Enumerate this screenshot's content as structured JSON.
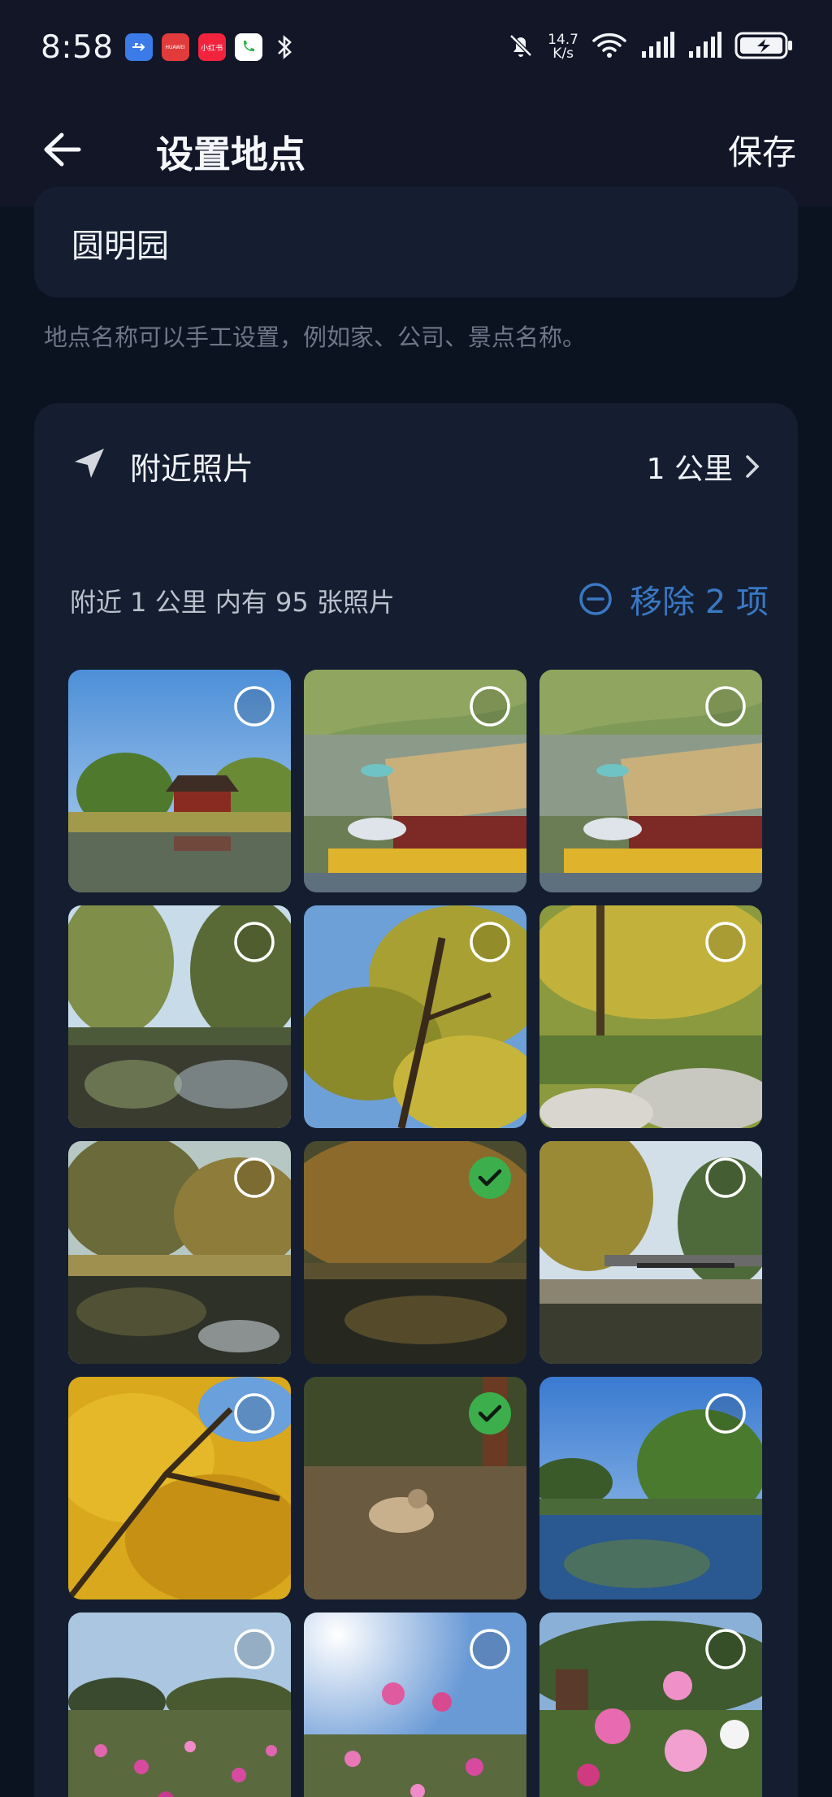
{
  "status_bar": {
    "time": "8:58",
    "notification_icons": [
      "usb-icon",
      "huawei-app-icon",
      "xiaohongshu-icon",
      "phone-call-icon",
      "bluetooth-icon"
    ],
    "notif_labels": {
      "huawei": "HUAWEI",
      "xiaohongshu": "小红书"
    },
    "net_speed_value": "14.7",
    "net_speed_unit": "K/s",
    "right_icons": [
      "mute-bell-icon",
      "wifi-icon",
      "signal-icon",
      "signal-icon",
      "battery-charging-icon"
    ]
  },
  "header": {
    "title": "设置地点",
    "save_label": "保存"
  },
  "location": {
    "name": "圆明园",
    "hint": "地点名称可以手工设置，例如家、公司、景点名称。"
  },
  "nearby": {
    "title": "附近照片",
    "radius": "1 公里",
    "count_text": "附近 1 公里 内有 95 张照片",
    "remove_label": "移除 2 项"
  },
  "colors": {
    "accent": "#3a78c4",
    "check_green": "#3cae4c",
    "card": "#141e30",
    "background": "#0b1321"
  },
  "photos": [
    {
      "scene": "pavilion-lake",
      "selected": false
    },
    {
      "scene": "boat-willows",
      "selected": false
    },
    {
      "scene": "boat-willows",
      "selected": false
    },
    {
      "scene": "willow-pond",
      "selected": false
    },
    {
      "scene": "yellow-tree-sky",
      "selected": false
    },
    {
      "scene": "yellow-tree-rocks",
      "selected": false
    },
    {
      "scene": "autumn-pond",
      "selected": false
    },
    {
      "scene": "dark-pond",
      "selected": true
    },
    {
      "scene": "bridge-pond",
      "selected": false
    },
    {
      "scene": "golden-canopy",
      "selected": false
    },
    {
      "scene": "bird-ground",
      "selected": true
    },
    {
      "scene": "blue-lake",
      "selected": false
    },
    {
      "scene": "cosmos-field",
      "selected": false
    },
    {
      "scene": "cosmos-sun",
      "selected": false
    },
    {
      "scene": "cosmos-closeup",
      "selected": false
    }
  ]
}
